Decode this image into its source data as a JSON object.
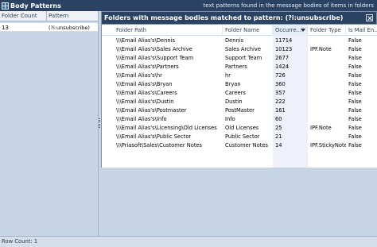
{
  "titlebar": {
    "title": "Body Patterns",
    "description": "text patterns found in the message bodies of items in folders"
  },
  "left": {
    "columns": [
      "Folder Count",
      "Pattern"
    ],
    "rows": [
      {
        "count": "13",
        "pattern": "(?i:unsubscribe)"
      }
    ]
  },
  "right": {
    "panel_title": "Folders with message bodies matched to pattern: (?i:unsubscribe)",
    "columns": [
      "Folder Path",
      "Folder Name",
      "Occurre...",
      "Folder Type",
      "Is Mail En..."
    ],
    "rows": [
      {
        "path": "\\\\\\Email Alias's\\Dennis",
        "name": "Dennis",
        "occ": "11714",
        "type": "",
        "mail": "False"
      },
      {
        "path": "\\\\\\Email Alias's\\Sales Archive",
        "name": "Sales Archive",
        "occ": "10123",
        "type": "IPF.Note",
        "mail": "False"
      },
      {
        "path": "\\\\\\Email Alias's\\Support Team",
        "name": "Support Team",
        "occ": "2677",
        "type": "",
        "mail": "False"
      },
      {
        "path": "\\\\\\Email Alias's\\Partners",
        "name": "Partners",
        "occ": "1424",
        "type": "",
        "mail": "False"
      },
      {
        "path": "\\\\\\Email Alias's\\hr",
        "name": "hr",
        "occ": "726",
        "type": "",
        "mail": "False"
      },
      {
        "path": "\\\\\\Email Alias's\\Bryan",
        "name": "Bryan",
        "occ": "360",
        "type": "",
        "mail": "False"
      },
      {
        "path": "\\\\\\Email Alias's\\Careers",
        "name": "Careers",
        "occ": "357",
        "type": "",
        "mail": "False"
      },
      {
        "path": "\\\\\\Email Alias's\\Dustin",
        "name": "Dustin",
        "occ": "222",
        "type": "",
        "mail": "False"
      },
      {
        "path": "\\\\\\Email Alias's\\Postmaster",
        "name": "PostMaster",
        "occ": "161",
        "type": "",
        "mail": "False"
      },
      {
        "path": "\\\\\\Email Alias's\\Info",
        "name": "Info",
        "occ": "60",
        "type": "",
        "mail": "False"
      },
      {
        "path": "\\\\\\Email Alias's\\Licensing\\Old Licenses",
        "name": "Old Licenses",
        "occ": "25",
        "type": "IPF.Note",
        "mail": "False"
      },
      {
        "path": "\\\\\\Email Alias's\\Public Sector",
        "name": "Public Sector",
        "occ": "21",
        "type": "",
        "mail": "False"
      },
      {
        "path": "\\\\\\Priasoft\\Sales\\Customer Notes",
        "name": "Customer Notes",
        "occ": "14",
        "type": "IPF.StickyNote",
        "mail": "False"
      }
    ]
  },
  "status": {
    "row_count": "Row Count: 1"
  },
  "colors": {
    "titlebar_bg": "#2a4363",
    "pane_bg": "#c7d4e6",
    "selected_column_bg": "#eef1fa"
  },
  "icons": {
    "app": "grid-icon",
    "close": "close-icon",
    "sort": "sort-descending-icon"
  }
}
